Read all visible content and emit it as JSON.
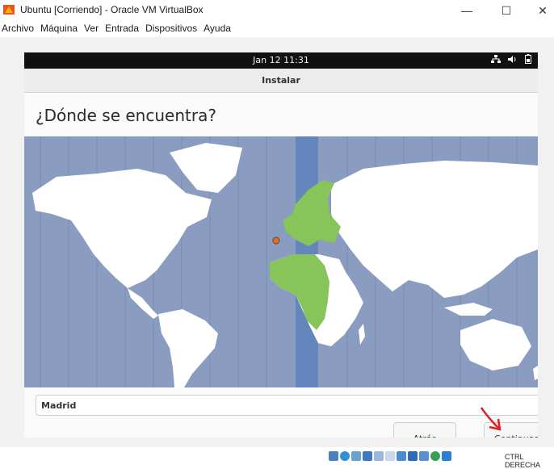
{
  "window": {
    "title": "Ubuntu [Corriendo] - Oracle VM VirtualBox"
  },
  "menu": [
    "Archivo",
    "Máquina",
    "Ver",
    "Entrada",
    "Dispositivos",
    "Ayuda"
  ],
  "guest": {
    "clock": "Jan 12  11:31",
    "dialog_title": "Instalar",
    "question": "¿Dónde se encuentra?",
    "timezone_value": "Madrid",
    "back_label": "Atrás",
    "continue_label": "Continuar"
  },
  "status": {
    "host_key": "CTRL DERECHA"
  },
  "colors": {
    "ocean": "#8a9cc0",
    "land": "#ffffff",
    "selected_zone": "#87c45a",
    "selected_band": "#6586bc",
    "annotation_arrow": "#e02020"
  },
  "icons": [
    "virtualbox-logo-icon",
    "network-icon",
    "volume-icon",
    "battery-icon",
    "pointer-arrow-icon"
  ]
}
